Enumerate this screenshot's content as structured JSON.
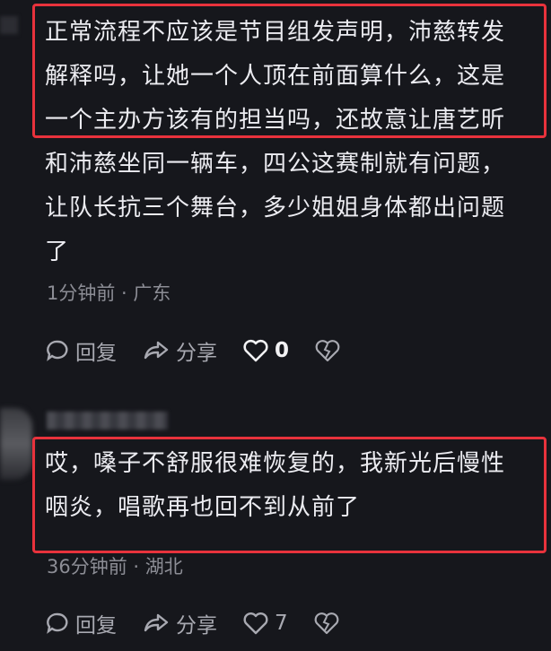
{
  "comments": [
    {
      "text": "正常流程不应该是节目组发声明，沛慈转发\n解释吗，让她一个人顶在前面算什么，这是\n一个主办方该有的担当吗，还故意让唐艺昕\n和沛慈坐同一辆车，四公这赛制就有问题，\n让队长抗三个舞台，多少姐姐身体都出问题\n了",
      "meta": "1分钟前 · 广东",
      "reply_label": "回复",
      "share_label": "分享",
      "like_count": "0"
    },
    {
      "text": "哎，嗓子不舒服很难恢复的，我新光后慢性\n咽炎，唱歌再也回不到从前了",
      "meta": "36分钟前 · 湖北",
      "reply_label": "回复",
      "share_label": "分享",
      "like_count": "7"
    }
  ],
  "icons": {
    "reply": "reply-bubble-icon",
    "share": "share-arrow-icon",
    "like": "heart-icon",
    "dislike": "broken-heart-icon"
  },
  "colors": {
    "highlight": "#e8323c",
    "background": "#16171c"
  }
}
